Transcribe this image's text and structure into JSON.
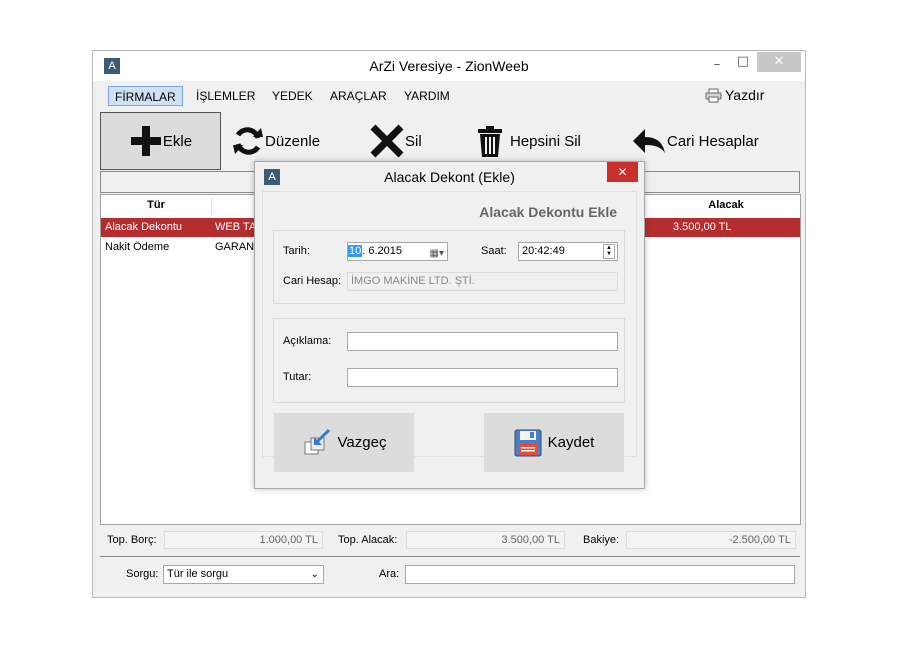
{
  "window": {
    "title": "ArZi Veresiye - ZionWeeb",
    "icon_letter": "A",
    "minimize": "–",
    "maximize": "□",
    "close": "✕"
  },
  "menu": {
    "items": [
      "FİRMALAR",
      "İŞLEMLER",
      "YEDEK",
      "ARAÇLAR",
      "YARDIM"
    ],
    "print": "Yazdır"
  },
  "toolbar": {
    "add": "Ekle",
    "edit": "Düzenle",
    "delete": "Sil",
    "delete_all": "Hepsini Sil",
    "accounts": "Cari Hesaplar"
  },
  "grid": {
    "columns": {
      "type": "Tür",
      "receivable": "Alacak"
    },
    "rows": [
      {
        "type": "Alacak Dekontu",
        "account": "WEB TA",
        "receivable": "3.500,00 TL",
        "selected": true
      },
      {
        "type": "Nakit Ödeme",
        "account": "GARANT",
        "receivable": "",
        "selected": false
      }
    ]
  },
  "totals": {
    "debt_label": "Top. Borç:",
    "debt_value": "1.000,00 TL",
    "receivable_label": "Top. Alacak:",
    "receivable_value": "3.500,00 TL",
    "balance_label": "Bakiye:",
    "balance_value": "-2.500,00 TL"
  },
  "query": {
    "label": "Sorgu:",
    "selected": "Tür ile sorgu",
    "search_label": "Ara:",
    "search_value": ""
  },
  "dialog": {
    "title": "Alacak Dekont (Ekle)",
    "close": "✕",
    "heading": "Alacak Dekontu Ekle",
    "date_label": "Tarih:",
    "date_day": "10",
    "date_rest": ". 6.2015",
    "time_label": "Saat:",
    "time_value": "20:42:49",
    "account_label": "Cari Hesap:",
    "account_value": "İMGO MAKİNE LTD. ŞTİ.",
    "description_label": "Açıklama:",
    "description_value": "",
    "amount_label": "Tutar:",
    "amount_value": "",
    "cancel": "Vazgeç",
    "save": "Kaydet"
  },
  "colors": {
    "selected_row": "#b62d2d",
    "dialog_close": "#c9302c",
    "menu_highlight": "#cfe1f7"
  }
}
